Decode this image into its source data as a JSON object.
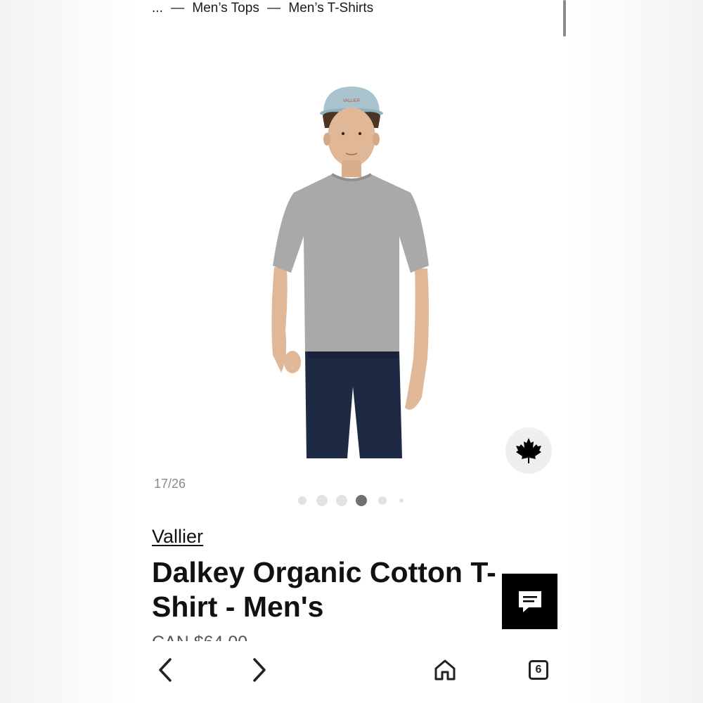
{
  "breadcrumb": {
    "ellipsis": "...",
    "separator_1": "—",
    "item_1": "Men’s Tops",
    "separator_2": "—",
    "item_2": "Men’s T-Shirts"
  },
  "gallery": {
    "counter": "17/26",
    "dots_count": 6,
    "active_dot": 3,
    "badge_icon": "maple-leaf-icon"
  },
  "product": {
    "brand": "Vallier",
    "title": "Dalkey Organic Cotton T-Shirt - Men's",
    "price_partial": "CAN $64.00"
  },
  "chat": {
    "icon": "chat-icon"
  },
  "bottom_nav": {
    "tab_count": "6",
    "icons": [
      "back-icon",
      "forward-icon",
      "home-icon",
      "tabs-icon"
    ]
  },
  "colors": {
    "tshirt": "#a9a9a9",
    "cap": "#a9c3cf",
    "pants": "#1e2a44",
    "accent_black": "#000000"
  }
}
